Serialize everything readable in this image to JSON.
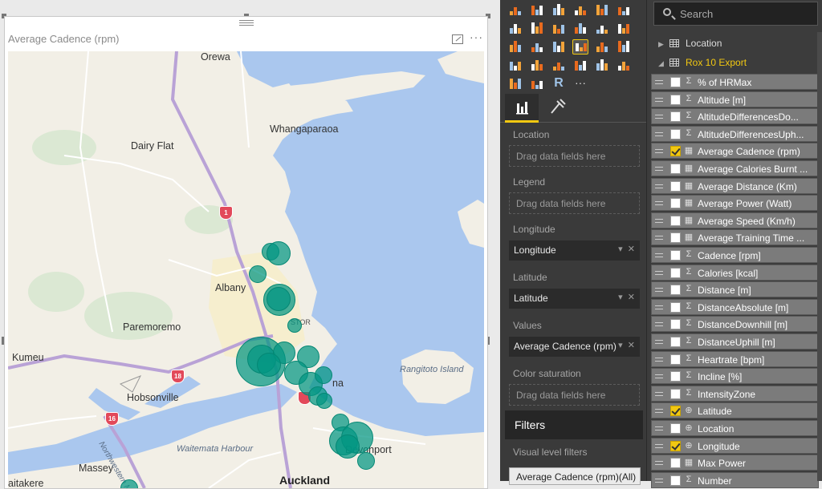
{
  "visual": {
    "title": "Average Cadence (rpm)",
    "more_label": "···"
  },
  "map": {
    "places": {
      "orewa": "Orewa",
      "whangaparaoa": "Whangaparaoa",
      "dairy_flat": "Dairy Flat",
      "albany": "Albany",
      "paremoremo": "Paremoremo",
      "kumeu": "Kumeu",
      "hobsonville": "Hobsonville",
      "rangitoto": "Rangitoto Island",
      "devonport": "Devonport",
      "massey": "Massey",
      "waitemata": "Waitemata Harbour",
      "auckland": "Auckland",
      "northwestern": "Northwestern M",
      "rosedale": "STOR",
      "takapuna_tail": "na",
      "waitakere_tail": "aitakere"
    },
    "road_shields": [
      "1",
      "18",
      "16"
    ],
    "colors": {
      "water": "#aac7ee",
      "land": "#f2efe6",
      "bubble": "#019682",
      "motorway": "#b9a2d6",
      "shield": "#e2495a"
    }
  },
  "viz_pane": {
    "more_visuals": "···",
    "r_visual": "R",
    "tabs": {
      "fields": "fields-tab",
      "format": "format-tab"
    },
    "wells": {
      "location_label": "Location",
      "location_placeholder": "Drag data fields here",
      "legend_label": "Legend",
      "legend_placeholder": "Drag data fields here",
      "longitude_label": "Longitude",
      "longitude_value": "Longitude",
      "latitude_label": "Latitude",
      "latitude_value": "Latitude",
      "values_label": "Values",
      "values_value": "Average Cadence (rpm)",
      "color_label": "Color saturation",
      "color_placeholder": "Drag data fields here"
    },
    "filters": {
      "header": "Filters",
      "visual_level": "Visual level filters",
      "chip": "Average Cadence (rpm)(All)"
    },
    "field_controls": {
      "dropdown": "▾",
      "remove": "✕"
    }
  },
  "fields_pane": {
    "search_placeholder": "Search",
    "tables": [
      {
        "name": "Location",
        "expanded": false,
        "caret": "▶"
      },
      {
        "name": "Rox 10 Export",
        "expanded": true,
        "caret": "◢"
      }
    ],
    "fields": [
      {
        "name": "% of HRMax",
        "type": "Σ",
        "checked": false
      },
      {
        "name": "Altitude [m]",
        "type": "Σ",
        "checked": false
      },
      {
        "name": "AltitudeDifferencesDo...",
        "type": "Σ",
        "checked": false
      },
      {
        "name": "AltitudeDifferencesUph...",
        "type": "Σ",
        "checked": false
      },
      {
        "name": "Average Cadence (rpm)",
        "type": "▦",
        "checked": true
      },
      {
        "name": "Average Calories Burnt ...",
        "type": "▦",
        "checked": false
      },
      {
        "name": "Average Distance (Km)",
        "type": "▦",
        "checked": false
      },
      {
        "name": "Average Power (Watt)",
        "type": "▦",
        "checked": false
      },
      {
        "name": "Average Speed (Km/h)",
        "type": "▦",
        "checked": false
      },
      {
        "name": "Average Training Time ...",
        "type": "▦",
        "checked": false
      },
      {
        "name": "Cadence [rpm]",
        "type": "Σ",
        "checked": false
      },
      {
        "name": "Calories [kcal]",
        "type": "Σ",
        "checked": false
      },
      {
        "name": "Distance [m]",
        "type": "Σ",
        "checked": false
      },
      {
        "name": "DistanceAbsolute [m]",
        "type": "Σ",
        "checked": false
      },
      {
        "name": "DistanceDownhill [m]",
        "type": "Σ",
        "checked": false
      },
      {
        "name": "DistanceUphill [m]",
        "type": "Σ",
        "checked": false
      },
      {
        "name": "Heartrate [bpm]",
        "type": "Σ",
        "checked": false
      },
      {
        "name": "Incline [%]",
        "type": "Σ",
        "checked": false
      },
      {
        "name": "IntensityZone",
        "type": "Σ",
        "checked": false
      },
      {
        "name": "Latitude",
        "type": "⊕",
        "checked": true
      },
      {
        "name": "Location",
        "type": "⊕",
        "checked": false
      },
      {
        "name": "Longitude",
        "type": "⊕",
        "checked": true
      },
      {
        "name": "Max Power",
        "type": "▦",
        "checked": false
      },
      {
        "name": "Number",
        "type": "Σ",
        "checked": false
      }
    ]
  }
}
